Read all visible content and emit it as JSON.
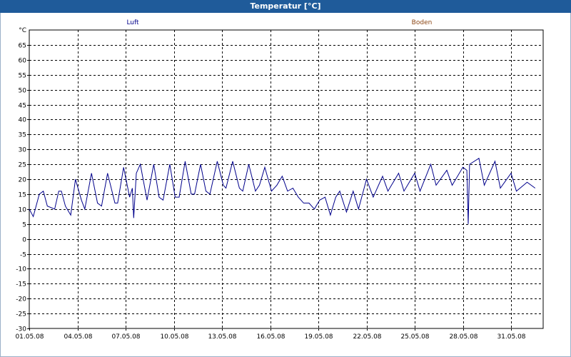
{
  "window": {
    "title": "Temperatur [°C]"
  },
  "chart_data": {
    "type": "line",
    "title": "Temperatur [°C]",
    "ylabel": "°C",
    "xlabel": "",
    "ylim": [
      -30,
      70
    ],
    "yticks": [
      65,
      60,
      55,
      50,
      45,
      40,
      35,
      30,
      25,
      20,
      15,
      10,
      5,
      0,
      -5,
      -10,
      -15,
      -20,
      -25,
      -30
    ],
    "xlim": [
      "01.05.08",
      "02.06.08"
    ],
    "xticks": [
      "01.05.08",
      "04.05.08",
      "07.05.08",
      "10.05.08",
      "13.05.08",
      "16.05.08",
      "19.05.08",
      "22.05.08",
      "25.05.08",
      "28.05.08",
      "31.05.08"
    ],
    "grid": true,
    "legend": [
      {
        "name": "Luft",
        "color": "#00008b"
      },
      {
        "name": "Boden",
        "color": "#8b4513"
      }
    ],
    "series": [
      {
        "name": "Luft",
        "color": "#00008b",
        "points": [
          [
            "01.05.08 00:00",
            10
          ],
          [
            "01.05.08 06:00",
            7.5
          ],
          [
            "01.05.08 15:00",
            15
          ],
          [
            "01.05.08 21:00",
            16
          ],
          [
            "02.05.08 03:00",
            11
          ],
          [
            "02.05.08 14:00",
            10
          ],
          [
            "02.05.08 20:00",
            16
          ],
          [
            "03.05.08 00:00",
            16
          ],
          [
            "03.05.08 06:00",
            11
          ],
          [
            "03.05.08 14:00",
            8
          ],
          [
            "03.05.08 21:00",
            20
          ],
          [
            "04.05.08 06:00",
            13
          ],
          [
            "04.05.08 11:00",
            10
          ],
          [
            "04.05.08 21:00",
            22
          ],
          [
            "05.05.08 06:00",
            12
          ],
          [
            "05.05.08 12:00",
            11
          ],
          [
            "05.05.08 21:00",
            22
          ],
          [
            "06.05.08 08:00",
            12
          ],
          [
            "06.05.08 12:00",
            12
          ],
          [
            "06.05.08 21:00",
            24
          ],
          [
            "07.05.08 06:00",
            14
          ],
          [
            "07.05.08 10:00",
            17
          ],
          [
            "07.05.08 12:00",
            7
          ],
          [
            "07.05.08 16:00",
            22
          ],
          [
            "07.05.08 22:00",
            25
          ],
          [
            "08.05.08 08:00",
            13
          ],
          [
            "08.05.08 18:00",
            25
          ],
          [
            "09.05.08 02:00",
            14
          ],
          [
            "09.05.08 08:00",
            13
          ],
          [
            "09.05.08 18:00",
            25
          ],
          [
            "10.05.08 02:00",
            14
          ],
          [
            "10.05.08 08:00",
            14
          ],
          [
            "10.05.08 17:00",
            26
          ],
          [
            "11.05.08 02:00",
            15
          ],
          [
            "11.05.08 07:00",
            15
          ],
          [
            "11.05.08 16:00",
            25
          ],
          [
            "12.05.08 00:00",
            16
          ],
          [
            "12.05.08 06:00",
            15
          ],
          [
            "12.05.08 17:00",
            26
          ],
          [
            "13.05.08 02:00",
            18
          ],
          [
            "13.05.08 06:00",
            17
          ],
          [
            "13.05.08 16:00",
            26
          ],
          [
            "14.05.08 02:00",
            17
          ],
          [
            "14.05.08 07:00",
            16
          ],
          [
            "14.05.08 16:00",
            25
          ],
          [
            "15.05.08 02:00",
            16
          ],
          [
            "15.05.08 08:00",
            18
          ],
          [
            "15.05.08 16:00",
            24
          ],
          [
            "16.05.08 02:00",
            16
          ],
          [
            "16.05.08 10:00",
            18
          ],
          [
            "16.05.08 18:00",
            21
          ],
          [
            "17.05.08 02:00",
            16
          ],
          [
            "17.05.08 10:00",
            17
          ],
          [
            "17.05.08 18:00",
            14
          ],
          [
            "18.05.08 02:00",
            12
          ],
          [
            "18.05.08 10:00",
            12
          ],
          [
            "18.05.08 18:00",
            10
          ],
          [
            "19.05.08 02:00",
            13
          ],
          [
            "19.05.08 10:00",
            14
          ],
          [
            "19.05.08 18:00",
            8
          ],
          [
            "20.05.08 02:00",
            14
          ],
          [
            "20.05.08 08:00",
            16
          ],
          [
            "20.05.08 18:00",
            9
          ],
          [
            "21.05.08 04:00",
            16
          ],
          [
            "21.05.08 12:00",
            10
          ],
          [
            "22.05.08 00:00",
            20
          ],
          [
            "22.05.08 10:00",
            14
          ],
          [
            "23.05.08 00:00",
            21
          ],
          [
            "23.05.08 08:00",
            16
          ],
          [
            "24.05.08 00:00",
            22
          ],
          [
            "24.05.08 08:00",
            16
          ],
          [
            "25.05.08 00:00",
            22
          ],
          [
            "25.05.08 08:00",
            16
          ],
          [
            "26.05.08 00:00",
            25
          ],
          [
            "26.05.08 08:00",
            18
          ],
          [
            "27.05.08 00:00",
            23
          ],
          [
            "27.05.08 08:00",
            18
          ],
          [
            "28.05.08 00:00",
            24
          ],
          [
            "28.05.08 06:00",
            23
          ],
          [
            "28.05.08 08:00",
            5
          ],
          [
            "28.05.08 10:00",
            25
          ],
          [
            "29.05.08 00:00",
            27
          ],
          [
            "29.05.08 08:00",
            18
          ],
          [
            "30.05.08 00:00",
            26
          ],
          [
            "30.05.08 08:00",
            17
          ],
          [
            "31.05.08 00:00",
            22
          ],
          [
            "31.05.08 08:00",
            16
          ],
          [
            "01.06.08 00:00",
            19
          ],
          [
            "01.06.08 12:00",
            17
          ]
        ]
      }
    ]
  }
}
